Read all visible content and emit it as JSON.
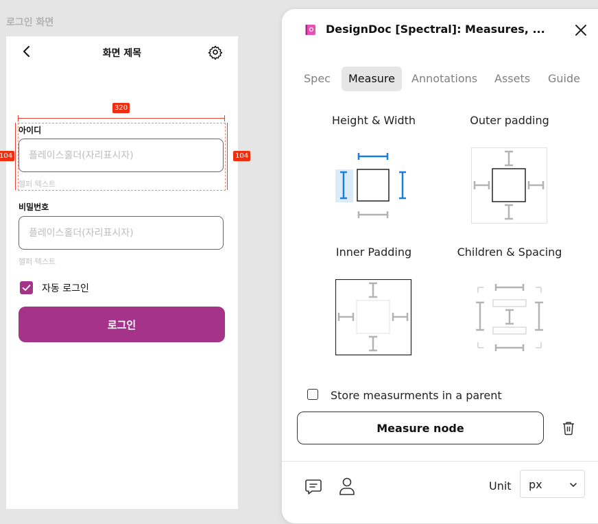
{
  "frame": {
    "label": "로그인 화면"
  },
  "phone": {
    "title": "화면 제목",
    "id_field": {
      "label": "아이디",
      "placeholder": "플레이스홀더(자리표시자)",
      "helper": "헬퍼 텍스트"
    },
    "pw_field": {
      "label": "비밀번호",
      "placeholder": "플레이스홀더(자리표시자)",
      "helper": "헬퍼 텍스트"
    },
    "auto_login": {
      "label": "자동 로그인",
      "checked": true
    },
    "login_button": "로그인",
    "accent_color": "#a6338a"
  },
  "measure_overlay": {
    "width_badge": "320",
    "height_badge_left": "104",
    "height_badge_right": "104",
    "color": "#ef2f0f"
  },
  "panel": {
    "title": "DesignDoc [Spectral]: Measures, ...",
    "tabs": [
      {
        "label": "Spec",
        "active": false
      },
      {
        "label": "Measure",
        "active": true
      },
      {
        "label": "Annotations",
        "active": false
      },
      {
        "label": "Assets",
        "active": false
      },
      {
        "label": "Guide",
        "active": false
      }
    ],
    "options": {
      "height_width": "Height & Width",
      "outer_padding": "Outer padding",
      "inner_padding": "Inner Padding",
      "children_spacing": "Children & Spacing"
    },
    "store_checkbox": {
      "label": "Store measurments in a parent",
      "checked": false
    },
    "measure_button": "Measure node",
    "unit": {
      "label": "Unit",
      "value": "px"
    },
    "accent_color": "#1a7fd6"
  }
}
